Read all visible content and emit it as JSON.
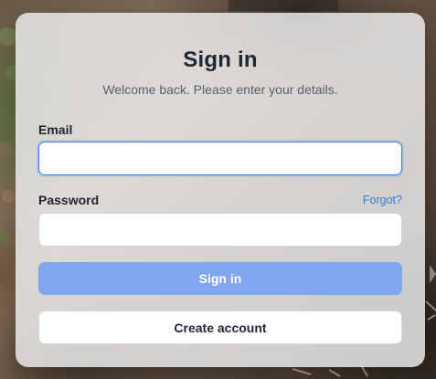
{
  "form": {
    "title": "Sign in",
    "subtitle": "Welcome back. Please enter your details.",
    "email_label": "Email",
    "email_value": "",
    "password_label": "Password",
    "password_value": "",
    "forgot_link": "Forgot?",
    "sign_in_button": "Sign in",
    "create_account_button": "Create account"
  },
  "colors": {
    "accent": "#3f7ae6",
    "primary_button_disabled": "#7fa6ef",
    "link": "#3a78e0",
    "card_background": "#ececec"
  }
}
